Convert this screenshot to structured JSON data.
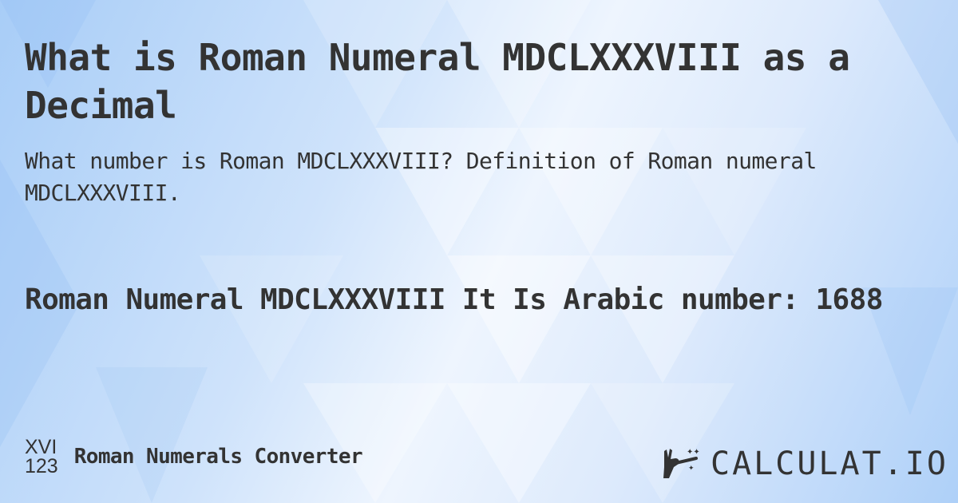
{
  "header": {
    "title": "What is Roman Numeral MDCLXXXVIII as a Decimal",
    "subtitle": "What number is Roman MDCLXXXVIII? Definition of Roman numeral MDCLXXXVIII."
  },
  "result": {
    "text": "Roman Numeral MDCLXXXVIII It Is  Arabic number: 1688",
    "roman": "MDCLXXXVIII",
    "arabic": "1688"
  },
  "footer": {
    "icon_top": "XVI",
    "icon_bottom": "123",
    "icon_name": "roman-numeral-icon",
    "label": "Roman Numerals Converter"
  },
  "brand": {
    "logo_text": "CALCULAT.IO",
    "logo_icon": "magic-wand-hand-icon"
  },
  "colors": {
    "text": "#333333",
    "bg_blue": "#a8cdf7",
    "bg_light": "#eef5fe"
  }
}
